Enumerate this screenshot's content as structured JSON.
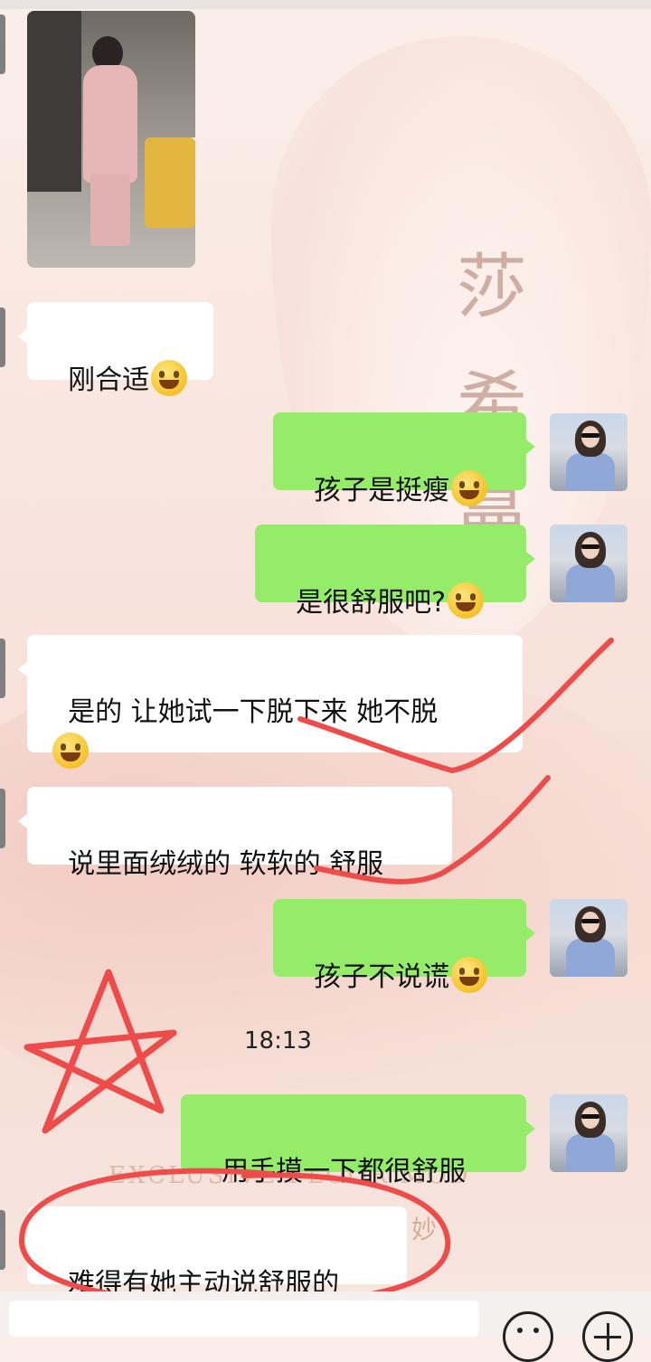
{
  "wallpaper": {
    "brand_chars": [
      "莎",
      "希",
      "曼"
    ],
    "brand_en": "EXCLUSIVE FLOOR MOD",
    "brand_small": "妙"
  },
  "messages": [
    {
      "side": "in",
      "type": "image",
      "desc_icon": "photo"
    },
    {
      "side": "in",
      "text": "刚合适",
      "emoji": "grinning-face"
    },
    {
      "side": "out",
      "text": "孩子是挺瘦",
      "emoji": "grimacing-face"
    },
    {
      "side": "out",
      "text": "是很舒服吧?",
      "emoji": "smiling-face"
    },
    {
      "side": "in",
      "text_line1": "是的 让她试一下脱下来 她不脱",
      "emoji": "tears-of-joy-face"
    },
    {
      "side": "in",
      "text": "说里面绒绒的 软软的 舒服"
    },
    {
      "side": "out",
      "text": "孩子不说谎",
      "emoji": "hand-over-mouth-face"
    },
    {
      "side": "out",
      "text": "用手摸一下都很舒服"
    },
    {
      "side": "in",
      "text": "难得有她主动说舒服的"
    }
  ],
  "timestamp": "18:13",
  "colors": {
    "outgoing_bubble": "#95ec69",
    "incoming_bubble": "#ffffff",
    "annotation_red": "#ee4b4b"
  },
  "input_bar": {
    "emoji_button_icon": "smile-icon",
    "more_button_icon": "plus-icon"
  }
}
